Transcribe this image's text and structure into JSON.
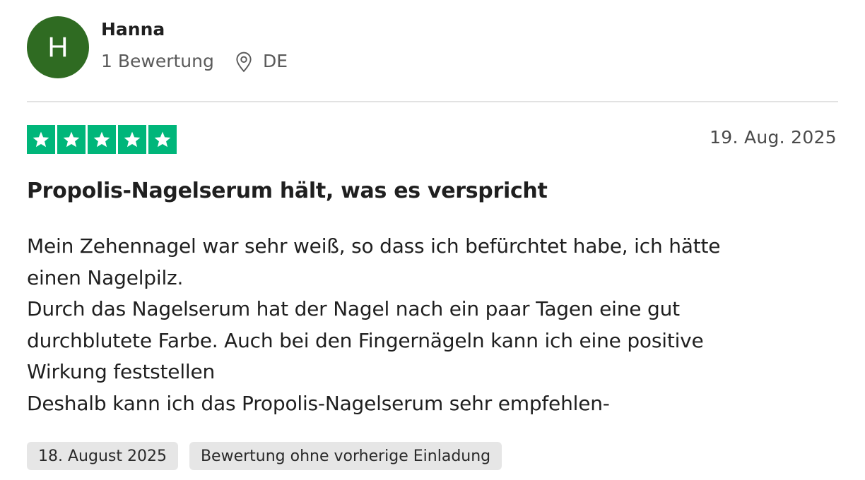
{
  "reviewer": {
    "initial": "H",
    "name": "Hanna",
    "review_count": "1 Bewertung",
    "country": "DE",
    "avatar_color": "#2f6b22"
  },
  "review": {
    "rating": 5,
    "max_rating": 5,
    "star_color": "#00b67a",
    "date": "19. Aug. 2025",
    "title": "Propolis-Nagelserum hält, was es verspricht",
    "body_lines": [
      "Mein Zehennagel war sehr weiß, so dass ich befürchtet habe, ich hätte",
      "einen Nagelpilz.",
      "Durch das Nagelserum hat der Nagel nach ein paar Tagen eine gut",
      "durchblutete Farbe. Auch bei den Fingernägeln kann ich eine positive",
      "Wirkung feststellen",
      "Deshalb kann ich das Propolis-Nagelserum sehr empfehlen-"
    ],
    "tags": [
      "18. August 2025",
      "Bewertung ohne vorherige Einladung"
    ]
  },
  "icons": {
    "location": "location-pin-icon",
    "star": "star-icon"
  }
}
